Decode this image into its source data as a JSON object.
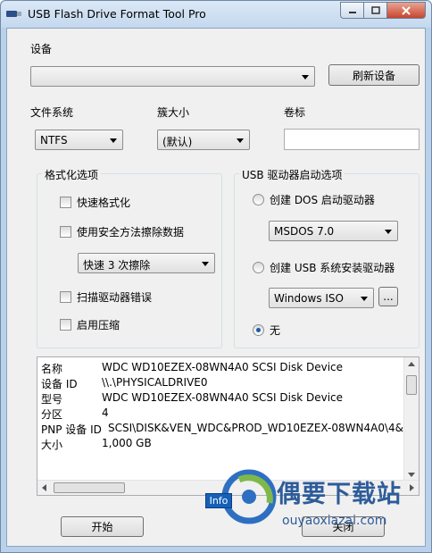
{
  "window": {
    "title": "USB Flash Drive Format Tool Pro"
  },
  "device": {
    "label": "设备",
    "selected": "",
    "refresh_label": "刷新设备"
  },
  "filesystem": {
    "label": "文件系统",
    "selected": "NTFS"
  },
  "cluster": {
    "label": "簇大小",
    "selected": "(默认)"
  },
  "volume": {
    "label": "卷标",
    "value": ""
  },
  "format_options": {
    "title": "格式化选项",
    "quick_format": "快速格式化",
    "secure_erase": "使用安全方法擦除数据",
    "erase_mode": "快速 3 次擦除",
    "scan_errors": "扫描驱动器错误",
    "compression": "启用压缩"
  },
  "boot_options": {
    "title": "USB 驱动器启动选项",
    "dos_label": "创建 DOS 启动驱动器",
    "dos_version": "MSDOS 7.0",
    "usb_install_label": "创建 USB 系统安装驱动器",
    "iso_selected": "Windows ISO",
    "browse_label": "...",
    "none_label": "无"
  },
  "info_rows": [
    {
      "key": "名称",
      "value": "WDC WD10EZEX-08WN4A0 SCSI Disk Device"
    },
    {
      "key": "设备 ID",
      "value": " \\\\.\\PHYSICALDRIVE0"
    },
    {
      "key": "型号",
      "value": "WDC WD10EZEX-08WN4A0 SCSI Disk Device"
    },
    {
      "key": "分区",
      "value": "4"
    },
    {
      "key": "PNP 设备 ID",
      "value": "SCSI\\DISK&VEN_WDC&PROD_WD10EZEX-08WN4A0\\4&"
    },
    {
      "key": "大小",
      "value": "1,000 GB"
    }
  ],
  "actions": {
    "start_label": "开始",
    "close_label": "关闭",
    "info_badge": "Info"
  },
  "watermark": {
    "text": "偶要下载站",
    "url": "ouyaoxiazai.com"
  },
  "colors": {
    "accent": "#1e5aa8",
    "watermark": "#2e5c9a"
  }
}
